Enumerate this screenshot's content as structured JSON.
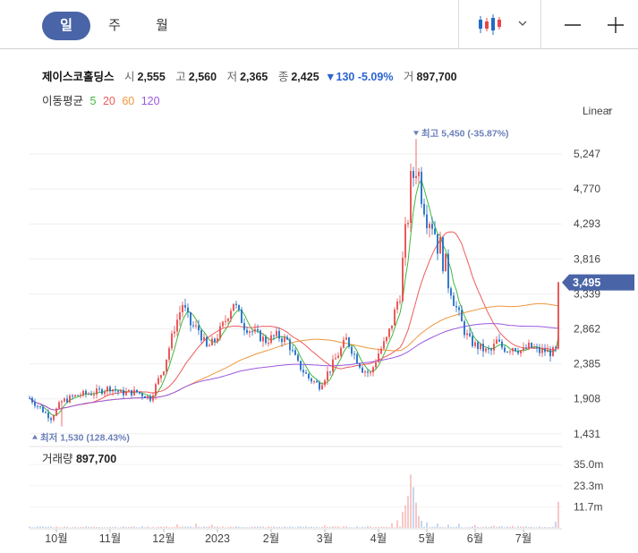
{
  "tabs": [
    {
      "label": "일",
      "active": true
    },
    {
      "label": "주",
      "active": false
    },
    {
      "label": "월",
      "active": false
    }
  ],
  "controls": {
    "chart_type_icon": "candlestick-icon",
    "minus_icon": "minus-icon",
    "plus_icon": "plus-icon",
    "dropdown_icon": "chevron-down-icon"
  },
  "stock": {
    "name": "제이스코홀딩스",
    "open_label": "시",
    "open": "2,555",
    "high_label": "고",
    "high": "2,560",
    "low_label": "저",
    "low": "2,365",
    "close_label": "종",
    "close": "2,425",
    "change": "▼130 -5.09%",
    "volume_label": "거",
    "volume": "897,700"
  },
  "moving_average": {
    "label": "이동평균",
    "periods": [
      {
        "label": "5",
        "color": "#3fb83f"
      },
      {
        "label": "20",
        "color": "#ef5b5b"
      },
      {
        "label": "60",
        "color": "#f0963c"
      },
      {
        "label": "120",
        "color": "#9b59e0"
      }
    ]
  },
  "scale_mode": "Linear",
  "chart_data": {
    "type": "candlestick",
    "y_ticks": [
      "5,247",
      "4,770",
      "4,293",
      "3,816",
      "3,339",
      "2,862",
      "2,385",
      "1,908",
      "1,431"
    ],
    "y_tick_values": [
      5247,
      4770,
      4293,
      3816,
      3339,
      2862,
      2385,
      1908,
      1431
    ],
    "ylim": [
      1431,
      5724
    ],
    "x_labels": [
      "10월",
      "11월",
      "12월",
      "2023",
      "2월",
      "3월",
      "4월",
      "5월",
      "6월",
      "7월"
    ],
    "current_price_label": "3,495",
    "current_price": 3495,
    "max_label": "최고 5,450 (-35.87%)",
    "max_value": 5450,
    "min_label": "최저 1,530 (128.43%)",
    "min_value": 1530,
    "colors": {
      "up": "#e8484a",
      "down": "#1f6cc7",
      "current": "#4a64a8",
      "marker": "#6b7fb8"
    },
    "price_path": [
      [
        0,
        1920
      ],
      [
        4,
        1780
      ],
      [
        8,
        1650
      ],
      [
        12,
        1870
      ],
      [
        18,
        1960
      ],
      [
        24,
        1990
      ],
      [
        30,
        2060
      ],
      [
        34,
        1990
      ],
      [
        40,
        2000
      ],
      [
        45,
        1920
      ],
      [
        50,
        2330
      ],
      [
        54,
        2880
      ],
      [
        57,
        3200
      ],
      [
        60,
        2920
      ],
      [
        63,
        2850
      ],
      [
        66,
        2600
      ],
      [
        69,
        2700
      ],
      [
        73,
        2980
      ],
      [
        76,
        3230
      ],
      [
        80,
        2900
      ],
      [
        84,
        2800
      ],
      [
        88,
        2700
      ],
      [
        92,
        2770
      ],
      [
        96,
        2700
      ],
      [
        100,
        2380
      ],
      [
        104,
        2190
      ],
      [
        108,
        2090
      ],
      [
        112,
        2320
      ],
      [
        115,
        2520
      ],
      [
        118,
        2720
      ],
      [
        121,
        2510
      ],
      [
        124,
        2310
      ],
      [
        127,
        2250
      ],
      [
        130,
        2530
      ],
      [
        133,
        2720
      ],
      [
        136,
        3050
      ],
      [
        138,
        3420
      ],
      [
        140,
        4080
      ],
      [
        142,
        4800
      ],
      [
        144,
        5130
      ],
      [
        146,
        4780
      ],
      [
        148,
        4480
      ],
      [
        150,
        4350
      ],
      [
        152,
        4050
      ],
      [
        154,
        3850
      ],
      [
        156,
        3520
      ],
      [
        158,
        3240
      ],
      [
        160,
        3050
      ],
      [
        162,
        2830
      ],
      [
        164,
        2700
      ],
      [
        166,
        2640
      ],
      [
        168,
        2600
      ],
      [
        170,
        2560
      ],
      [
        172,
        2560
      ],
      [
        174,
        2690
      ],
      [
        176,
        2610
      ],
      [
        178,
        2580
      ],
      [
        180,
        2620
      ],
      [
        182,
        2580
      ],
      [
        184,
        2560
      ],
      [
        186,
        2620
      ],
      [
        188,
        2590
      ],
      [
        190,
        2550
      ],
      [
        192,
        2560
      ],
      [
        194,
        2540
      ],
      [
        196,
        2560
      ],
      [
        197,
        3495
      ]
    ],
    "volume_label": "거래량",
    "volume_value": "897,700",
    "volume_ticks": [
      "35.0m",
      "23.3m",
      "11.7m"
    ],
    "volume_tick_values": [
      35.0,
      23.3,
      11.7
    ],
    "volume_max": 41,
    "volume_spikes": [
      [
        55,
        2.0
      ],
      [
        62,
        2.3
      ],
      [
        68,
        1.8
      ],
      [
        110,
        1.5
      ],
      [
        135,
        2.6
      ],
      [
        137,
        4.2
      ],
      [
        139,
        8.8
      ],
      [
        140,
        12.4
      ],
      [
        141,
        17.8
      ],
      [
        142,
        29.5
      ],
      [
        143,
        22.5
      ],
      [
        144,
        14.0
      ],
      [
        145,
        6.5
      ],
      [
        146,
        4.0
      ],
      [
        148,
        3.1
      ],
      [
        152,
        2.4
      ],
      [
        156,
        1.8
      ],
      [
        160,
        2.2
      ],
      [
        166,
        1.7
      ],
      [
        173,
        1.3
      ],
      [
        180,
        1.2
      ],
      [
        196,
        3.5
      ],
      [
        197,
        14.5
      ]
    ]
  }
}
